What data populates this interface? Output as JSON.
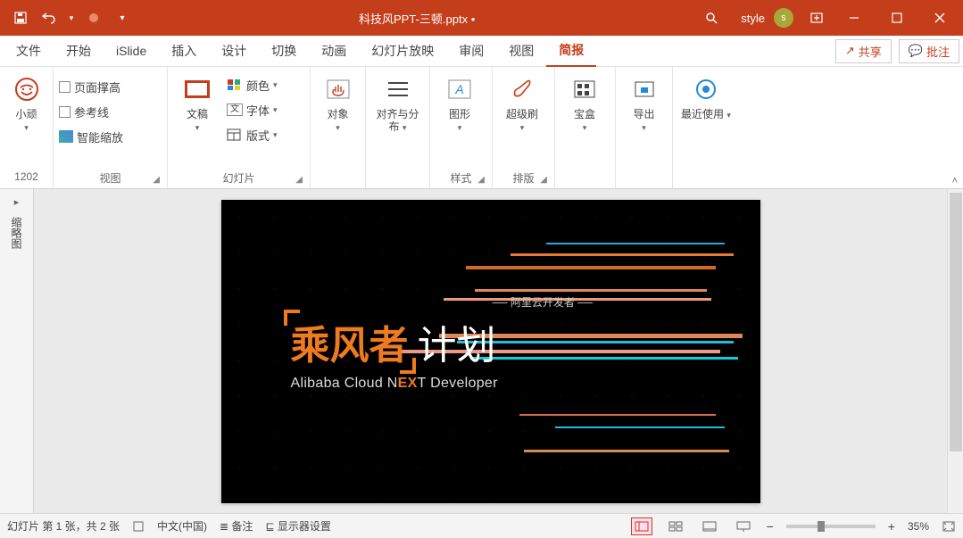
{
  "title_bar": {
    "filename": "科技风PPT-三顿.pptx •",
    "user_label": "style",
    "user_initial": "s"
  },
  "tabs": {
    "items": [
      "文件",
      "开始",
      "iSlide",
      "插入",
      "设计",
      "切换",
      "动画",
      "幻灯片放映",
      "审阅",
      "视图",
      "简报"
    ],
    "active_index": 10,
    "share": "共享",
    "comments": "批注"
  },
  "ribbon": {
    "group0": {
      "big_label": "小顽",
      "left_number": "1202"
    },
    "group1": {
      "label": "视图",
      "opt1": "页面撑高",
      "opt2": "参考线",
      "opt3": "智能缩放"
    },
    "group2": {
      "label": "幻灯片",
      "big": "文稿",
      "r1": "颜色",
      "r2": "字体",
      "r3": "版式"
    },
    "group3": {
      "big": "对象"
    },
    "group4": {
      "big": "对齐与分布"
    },
    "group5": {
      "label": "样式",
      "big": "图形"
    },
    "group6": {
      "label": "排版",
      "big": "超级刷"
    },
    "group7": {
      "big": "宝盒"
    },
    "group8": {
      "big": "导出"
    },
    "group9": {
      "big": "最近使用"
    }
  },
  "side": {
    "collapse": "▸",
    "label": "缩略图"
  },
  "slide": {
    "subtitle": "── 阿里云开发者 ──",
    "title_orange": "乘风者",
    "title_white": "计划",
    "en_pre": "Alibaba Cloud N",
    "en_mid": "EX",
    "en_post": "T Developer"
  },
  "status": {
    "slide_info": "幻灯片 第 1 张，共 2 张",
    "lang": "中文(中国)",
    "notes": "备注",
    "display": "显示器设置",
    "zoom": "35%"
  }
}
